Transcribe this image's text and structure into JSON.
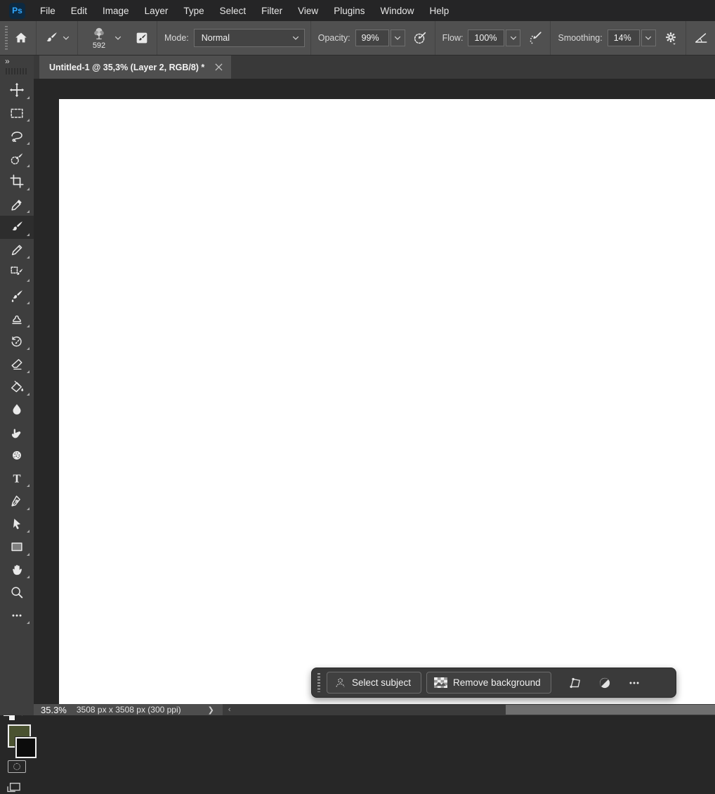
{
  "menubar": {
    "logo": "Ps",
    "items": [
      "File",
      "Edit",
      "Image",
      "Layer",
      "Type",
      "Select",
      "Filter",
      "View",
      "Plugins",
      "Window",
      "Help"
    ]
  },
  "options_bar": {
    "brush_preset": {
      "size": "592",
      "icon": "tree-brush-preview"
    },
    "mode": {
      "label": "Mode:",
      "value": "Normal"
    },
    "opacity": {
      "label": "Opacity:",
      "value": "99%"
    },
    "flow": {
      "label": "Flow:",
      "value": "100%"
    },
    "smoothing": {
      "label": "Smoothing:",
      "value": "14%"
    }
  },
  "document_tab": {
    "title": "Untitled-1 @ 35,3% (Layer 2, RGB/8) *"
  },
  "toolbar": {
    "tools": [
      {
        "icon": "move",
        "name": "move-tool"
      },
      {
        "icon": "marquee",
        "name": "rectangular-marquee-tool"
      },
      {
        "icon": "lasso",
        "name": "lasso-tool"
      },
      {
        "icon": "selection-brush",
        "name": "selection-brush-tool"
      },
      {
        "icon": "crop",
        "name": "crop-tool"
      },
      {
        "icon": "eyedropper",
        "name": "eyedropper-tool"
      },
      {
        "icon": "brush",
        "name": "brush-tool",
        "selected": true
      },
      {
        "icon": "pencil",
        "name": "pencil-tool"
      },
      {
        "icon": "adjustment-brush",
        "name": "adjustment-brush-tool"
      },
      {
        "icon": "mixer-brush",
        "name": "mixer-brush-tool"
      },
      {
        "icon": "clone-stamp",
        "name": "clone-stamp-tool"
      },
      {
        "icon": "history-brush",
        "name": "history-brush-tool"
      },
      {
        "icon": "eraser",
        "name": "eraser-tool"
      },
      {
        "icon": "paint-bucket",
        "name": "paint-bucket-tool"
      },
      {
        "icon": "blur",
        "name": "blur-tool",
        "flyout": false
      },
      {
        "icon": "smudge",
        "name": "smudge-tool",
        "flyout": false
      },
      {
        "icon": "sponge",
        "name": "sponge-tool",
        "flyout": false
      },
      {
        "icon": "type",
        "name": "type-tool"
      },
      {
        "icon": "pen",
        "name": "pen-tool"
      },
      {
        "icon": "path-select",
        "name": "path-selection-tool"
      },
      {
        "icon": "rectangle",
        "name": "rectangle-tool"
      },
      {
        "icon": "hand",
        "name": "hand-tool"
      },
      {
        "icon": "zoom",
        "name": "zoom-tool",
        "flyout": false
      },
      {
        "icon": "more",
        "name": "edit-toolbar-button"
      }
    ],
    "foreground_color": "#4a5230",
    "background_color": "#0c0c0c"
  },
  "task_bar": {
    "buttons": [
      {
        "icon": "person",
        "label": "Select subject",
        "name": "select-subject-button"
      },
      {
        "icon": "image-checker",
        "label": "Remove background",
        "name": "remove-background-button"
      }
    ],
    "icon_buttons": [
      {
        "icon": "transform-quad",
        "name": "transform-image-button"
      },
      {
        "icon": "contrast",
        "name": "adjustments-button"
      },
      {
        "icon": "more",
        "name": "task-bar-more-button"
      }
    ]
  },
  "status_bar": {
    "zoom": "35.3%",
    "doc_info": "3508 px x 3508 px (300 ppi)"
  },
  "colors": {
    "accent_blue": "#31a8ff",
    "panel_gray": "#505050",
    "pasteboard": "#272727"
  }
}
